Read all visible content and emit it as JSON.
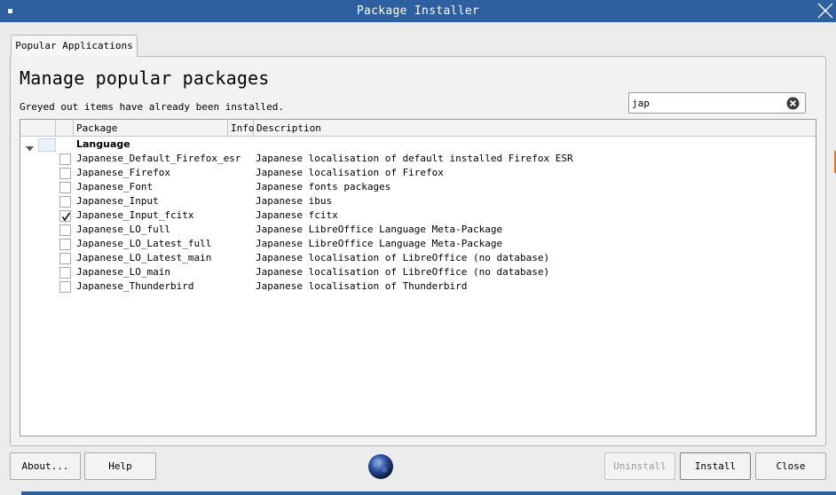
{
  "window": {
    "title": "Package Installer"
  },
  "tabs": [
    {
      "label": "Popular Applications"
    }
  ],
  "main": {
    "heading": "Manage popular packages",
    "subtitle": "Greyed out items have already been installed."
  },
  "search": {
    "value": "jap"
  },
  "table": {
    "columns": {
      "package": "Package",
      "info": "Info",
      "description": "Description"
    },
    "group": "Language",
    "rows": [
      {
        "package": "Japanese_Default_Firefox_esr",
        "description": "Japanese localisation of default installed Firefox ESR",
        "checked": false
      },
      {
        "package": "Japanese_Firefox",
        "description": "Japanese localisation of Firefox",
        "checked": false
      },
      {
        "package": "Japanese_Font",
        "description": "Japanese fonts packages",
        "checked": false
      },
      {
        "package": "Japanese_Input",
        "description": "Japanese ibus",
        "checked": false
      },
      {
        "package": "Japanese_Input_fcitx",
        "description": "Japanese fcitx",
        "checked": true
      },
      {
        "package": "Japanese_LO_full",
        "description": "Japanese LibreOffice Language Meta-Package",
        "checked": false
      },
      {
        "package": "Japanese_LO_Latest_full",
        "description": "Japanese LibreOffice Language Meta-Package",
        "checked": false
      },
      {
        "package": "Japanese_LO_Latest_main",
        "description": "Japanese localisation of LibreOffice (no database)",
        "checked": false
      },
      {
        "package": "Japanese_LO_main",
        "description": "Japanese localisation of LibreOffice (no database)",
        "checked": false
      },
      {
        "package": "Japanese_Thunderbird",
        "description": "Japanese localisation of Thunderbird",
        "checked": false
      }
    ]
  },
  "buttons": {
    "about": "About...",
    "help": "Help",
    "uninstall": "Uninstall",
    "install": "Install",
    "close": "Close"
  },
  "icons": {
    "close": "close-icon",
    "clear": "clear-search-icon",
    "expander": "chevron-down-icon",
    "globe": "globe-icon",
    "check": "checkmark-icon"
  },
  "colors": {
    "titlebar": "#2e5f9e",
    "background": "#ececec",
    "disabled_text": "#9a9a9a"
  }
}
